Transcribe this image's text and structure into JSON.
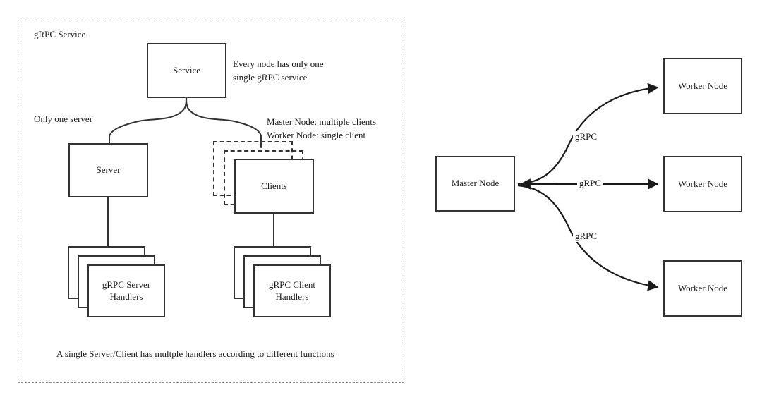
{
  "diagram": {
    "title_left": "gRPC Service",
    "caption_left": "A single Server/Client has multple handlers according to different functions",
    "colors": {
      "stroke": "#333333",
      "panel_border": "#8a8a8a",
      "text": "#1a1a1a",
      "background": "#ffffff"
    }
  },
  "left_panel": {
    "title": "gRPC Service",
    "caption": "A single Server/Client has multple handlers according to different functions",
    "nodes": {
      "service": "Service",
      "server": "Server",
      "clients": "Clients",
      "server_handlers": "gRPC Server\nHandlers",
      "server_handlers_line1": "gRPC Server",
      "server_handlers_line2": "Handlers",
      "client_handlers_line1": "gRPC Client",
      "client_handlers_line2": "Handlers"
    },
    "annotations": {
      "service_note_line1": "Every node has only one",
      "service_note_line2": "single gRPC service",
      "server_note": "Only one server",
      "clients_note_line1": "Master Node: multiple clients",
      "clients_note_line2": "Worker Node: single client"
    }
  },
  "right_panel": {
    "master": "Master Node",
    "workers": [
      "Worker Node",
      "Worker Node",
      "Worker Node"
    ],
    "edge_labels": [
      "gRPC",
      "gRPC",
      "gRPC"
    ]
  }
}
